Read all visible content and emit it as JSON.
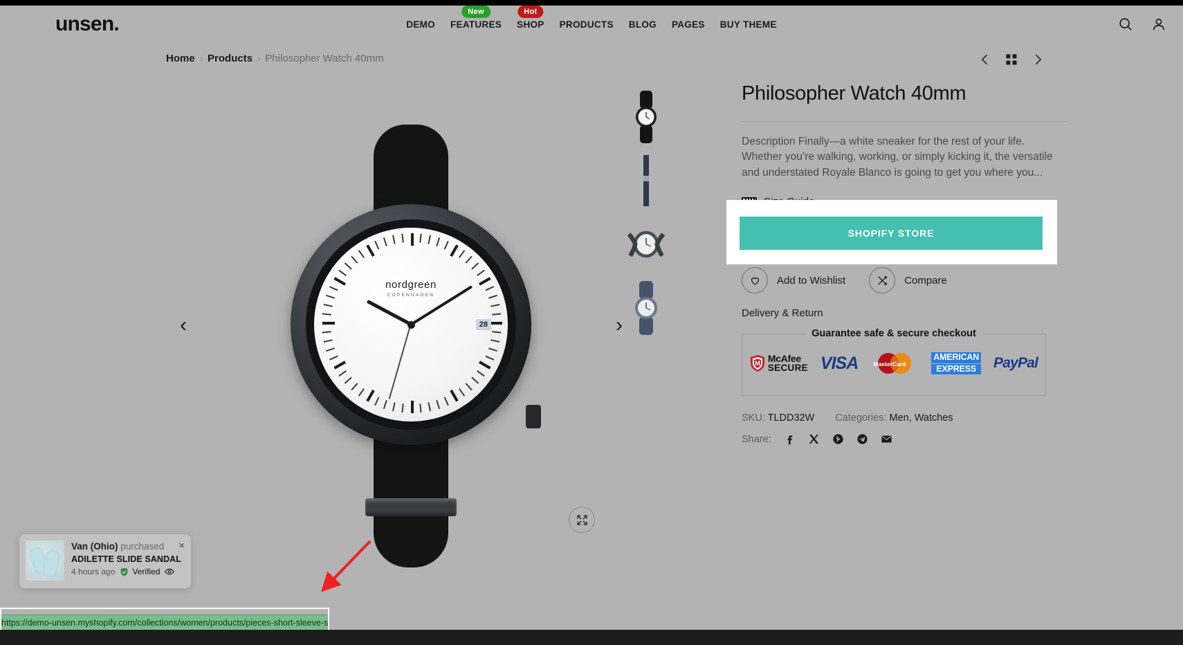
{
  "header": {
    "logo": "unsen.",
    "nav": [
      {
        "label": "DEMO",
        "badge": null
      },
      {
        "label": "FEATURES",
        "badge": "New",
        "badge_type": "new",
        "badge_color": "#2aa02a"
      },
      {
        "label": "SHOP",
        "badge": "Hot",
        "badge_type": "hot",
        "badge_color": "#c21a1a"
      },
      {
        "label": "PRODUCTS",
        "badge": null
      },
      {
        "label": "BLOG",
        "badge": null
      },
      {
        "label": "PAGES",
        "badge": null
      },
      {
        "label": "BUY THEME",
        "badge": null
      }
    ],
    "icons": [
      {
        "name": "search-icon"
      },
      {
        "name": "account-icon"
      }
    ]
  },
  "breadcrumb": {
    "home": "Home",
    "products": "Products",
    "current": "Philosopher Watch 40mm",
    "separator": "›"
  },
  "gallery_nav": {
    "prev": "‹",
    "grid": "grid-icon",
    "next": "›"
  },
  "gallery": {
    "prev_arrow": "‹",
    "next_arrow": "›",
    "zoom_icon": "expand-icon",
    "thumbnails": [
      {
        "name": "thumb-watch-front"
      },
      {
        "name": "thumb-watch-strap"
      },
      {
        "name": "thumb-watch-angle"
      },
      {
        "name": "thumb-watch-blue"
      }
    ],
    "watch": {
      "brand": "nordgreen",
      "brand_sub": "COPENHAGEN",
      "date": "28"
    }
  },
  "product": {
    "title": "Philosopher Watch 40mm",
    "description": "Description Finally—a white sneaker for the rest of your life. Whether you’re walking, working, or simply kicking it, the versatile and understated Royale Blanco is going to get you where you...",
    "size_guide": "Size Guide",
    "cta_label": "SHOPIFY STORE",
    "cta_color": "#44bfb0",
    "wishlist_label": "Add to Wishlist",
    "compare_label": "Compare",
    "delivery_return": "Delivery & Return",
    "guarantee_title": "Guarantee safe & secure checkout",
    "payment_badges": [
      {
        "name": "mcafee-secure-badge",
        "line1": "McAfee",
        "line2": "SECURE"
      },
      {
        "name": "visa-badge",
        "label": "VISA"
      },
      {
        "name": "mastercard-badge",
        "label": "MasterCard"
      },
      {
        "name": "amex-badge",
        "line1": "AMERICAN",
        "line2": "EXPRESS"
      },
      {
        "name": "paypal-badge",
        "label": "PayPal"
      }
    ],
    "sku_label": "SKU:",
    "sku_value": "TLDD32W",
    "categories_label": "Categories:",
    "categories": "Men, Watches",
    "share_label": "Share:",
    "share_icons": [
      {
        "name": "facebook-icon"
      },
      {
        "name": "x-twitter-icon"
      },
      {
        "name": "pinterest-icon"
      },
      {
        "name": "telegram-icon"
      },
      {
        "name": "email-icon"
      }
    ]
  },
  "notification": {
    "buyer": "Van (Ohio)",
    "action": "purchased",
    "product": "ADILETTE SLIDE SANDAL",
    "time": "4 hours ago",
    "verified": "Verified",
    "close": "×"
  },
  "status_bar": {
    "url": "https://demo-unsen.myshopify.com/collections/women/products/pieces-short-sleeve-sweater",
    "background": "#7bbd8a"
  }
}
